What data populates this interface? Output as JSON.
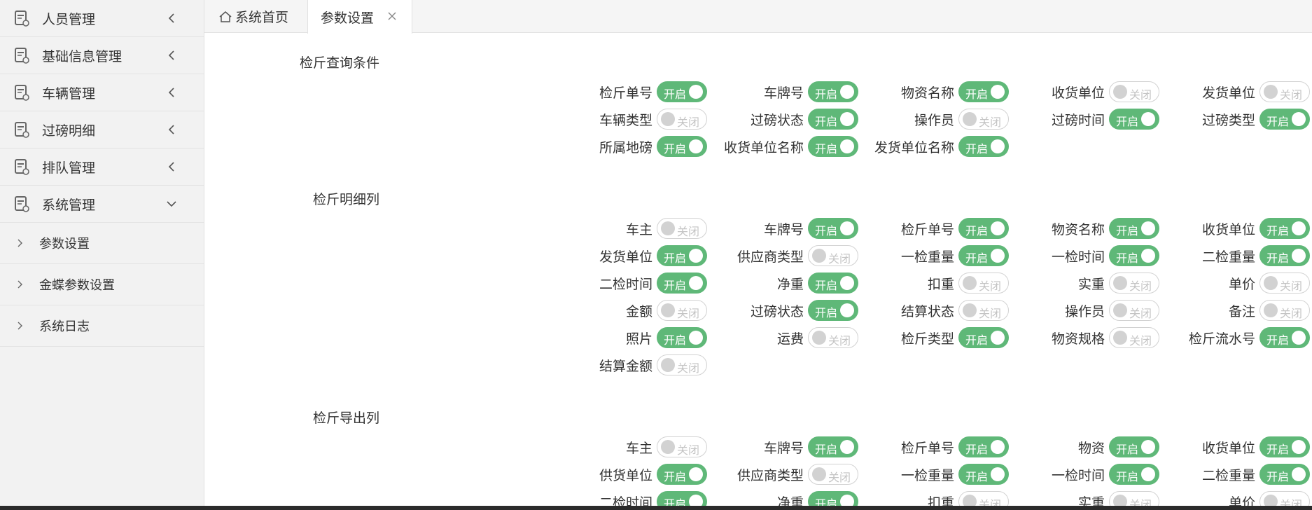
{
  "sidebar": {
    "menus": [
      {
        "label": "人员管理",
        "expanded": false
      },
      {
        "label": "基础信息管理",
        "expanded": false
      },
      {
        "label": "车辆管理",
        "expanded": false
      },
      {
        "label": "过磅明细",
        "expanded": false
      },
      {
        "label": "排队管理",
        "expanded": false
      },
      {
        "label": "系统管理",
        "expanded": true
      }
    ],
    "subitems": [
      {
        "label": "参数设置"
      },
      {
        "label": "金蝶参数设置"
      },
      {
        "label": "系统日志"
      }
    ]
  },
  "tabs": {
    "home_label": "系统首页",
    "active_label": "参数设置"
  },
  "toggle_text": {
    "on": "开启",
    "off": "关闭"
  },
  "colors": {
    "toggle_on": "#5fb878",
    "toggle_off_border": "#d2d2d2",
    "sidebar_bg": "#f2f2f2"
  },
  "sections": [
    {
      "title": "检斤查询条件",
      "fields": [
        {
          "label": "检斤单号",
          "on": true
        },
        {
          "label": "车牌号",
          "on": true
        },
        {
          "label": "物资名称",
          "on": true
        },
        {
          "label": "收货单位",
          "on": false
        },
        {
          "label": "发货单位",
          "on": false
        },
        {
          "label": "车辆类型",
          "on": false
        },
        {
          "label": "过磅状态",
          "on": true
        },
        {
          "label": "操作员",
          "on": false
        },
        {
          "label": "过磅时间",
          "on": true
        },
        {
          "label": "过磅类型",
          "on": true
        },
        {
          "label": "所属地磅",
          "on": true
        },
        {
          "label": "收货单位名称",
          "on": true
        },
        {
          "label": "发货单位名称",
          "on": true
        }
      ]
    },
    {
      "title": "检斤明细列",
      "fields": [
        {
          "label": "车主",
          "on": false
        },
        {
          "label": "车牌号",
          "on": true
        },
        {
          "label": "检斤单号",
          "on": true
        },
        {
          "label": "物资名称",
          "on": true
        },
        {
          "label": "收货单位",
          "on": true
        },
        {
          "label": "发货单位",
          "on": true
        },
        {
          "label": "供应商类型",
          "on": false
        },
        {
          "label": "一检重量",
          "on": true
        },
        {
          "label": "一检时间",
          "on": true
        },
        {
          "label": "二检重量",
          "on": true
        },
        {
          "label": "二检时间",
          "on": true
        },
        {
          "label": "净重",
          "on": true
        },
        {
          "label": "扣重",
          "on": false
        },
        {
          "label": "实重",
          "on": false
        },
        {
          "label": "单价",
          "on": false
        },
        {
          "label": "金额",
          "on": false
        },
        {
          "label": "过磅状态",
          "on": true
        },
        {
          "label": "结算状态",
          "on": false
        },
        {
          "label": "操作员",
          "on": false
        },
        {
          "label": "备注",
          "on": false
        },
        {
          "label": "照片",
          "on": true
        },
        {
          "label": "运费",
          "on": false
        },
        {
          "label": "检斤类型",
          "on": true
        },
        {
          "label": "物资规格",
          "on": false
        },
        {
          "label": "检斤流水号",
          "on": true
        },
        {
          "label": "结算金额",
          "on": false
        }
      ]
    },
    {
      "title": "检斤导出列",
      "fields": [
        {
          "label": "车主",
          "on": false
        },
        {
          "label": "车牌号",
          "on": true
        },
        {
          "label": "检斤单号",
          "on": true
        },
        {
          "label": "物资",
          "on": true
        },
        {
          "label": "收货单位",
          "on": true
        },
        {
          "label": "供货单位",
          "on": true
        },
        {
          "label": "供应商类型",
          "on": false
        },
        {
          "label": "一检重量",
          "on": true
        },
        {
          "label": "一检时间",
          "on": true
        },
        {
          "label": "二检重量",
          "on": true
        },
        {
          "label": "二检时间",
          "on": true
        },
        {
          "label": "净重",
          "on": true
        },
        {
          "label": "扣重",
          "on": false
        },
        {
          "label": "实重",
          "on": false
        },
        {
          "label": "单价",
          "on": false
        }
      ]
    }
  ]
}
